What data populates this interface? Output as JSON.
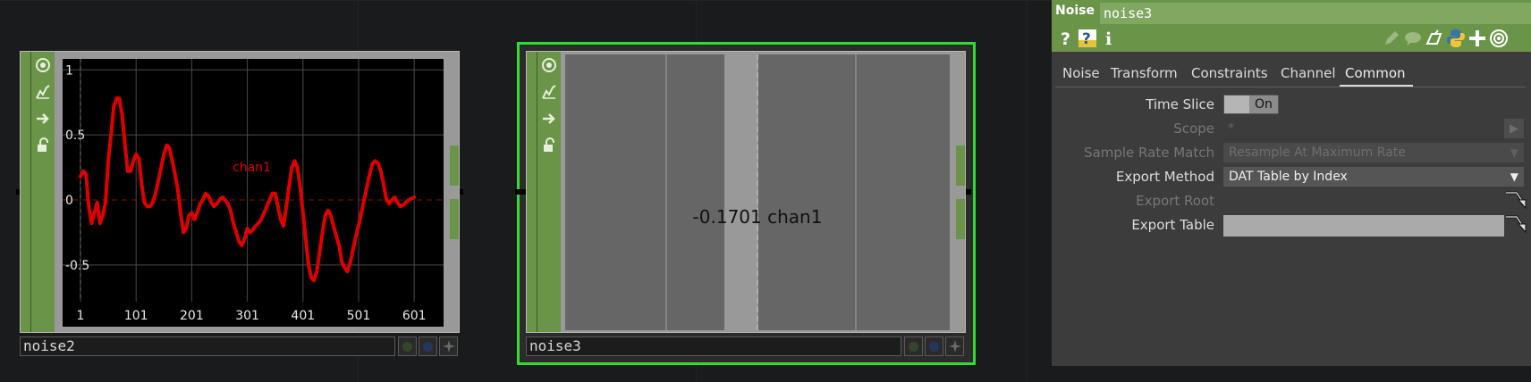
{
  "nodes": {
    "noise2": {
      "name": "noise2",
      "tools": [
        "viewer-active-icon",
        "graph-icon",
        "forward-arrow-icon",
        "lock-icon"
      ],
      "chart_data": {
        "type": "line",
        "title": "",
        "xlabel": "",
        "ylabel": "",
        "xlim": [
          1,
          620
        ],
        "ylim": [
          -0.7,
          1.05
        ],
        "x_ticks": [
          "1",
          "101",
          "201",
          "301",
          "401",
          "501",
          "601"
        ],
        "y_ticks": [
          "1",
          "0.5",
          "0",
          "-0.5"
        ],
        "grid": true,
        "series": [
          {
            "name": "chan1",
            "color": "#e00000",
            "x": [
              1,
              6,
              11,
              16,
              21,
              26,
              31,
              36,
              41,
              46,
              51,
              56,
              61,
              66,
              71,
              76,
              81,
              86,
              91,
              96,
              101,
              106,
              111,
              116,
              121,
              126,
              131,
              136,
              141,
              146,
              151,
              156,
              161,
              166,
              171,
              176,
              181,
              186,
              191,
              196,
              201,
              206,
              211,
              216,
              221,
              226,
              231,
              236,
              241,
              246,
              251,
              256,
              261,
              266,
              271,
              276,
              281,
              286,
              291,
              296,
              301,
              306,
              311,
              316,
              321,
              326,
              331,
              336,
              341,
              346,
              351,
              356,
              361,
              366,
              371,
              376,
              381,
              386,
              391,
              396,
              401,
              406,
              411,
              416,
              421,
              426,
              431,
              436,
              441,
              446,
              451,
              456,
              461,
              466,
              471,
              476,
              481,
              486,
              491,
              496,
              501,
              506,
              511,
              516,
              521,
              526,
              531,
              536,
              541,
              546,
              551,
              556,
              561,
              566,
              571,
              576,
              581,
              586,
              591,
              596,
              601
            ],
            "y": [
              0.18,
              0.22,
              0.2,
              -0.05,
              -0.18,
              -0.1,
              -0.02,
              -0.18,
              -0.12,
              -0.02,
              0.3,
              0.5,
              0.72,
              0.78,
              0.78,
              0.65,
              0.42,
              0.22,
              0.22,
              0.3,
              0.35,
              0.32,
              0.12,
              -0.02,
              -0.05,
              -0.05,
              -0.02,
              0.05,
              0.15,
              0.25,
              0.35,
              0.42,
              0.4,
              0.3,
              0.2,
              0.08,
              -0.1,
              -0.25,
              -0.22,
              -0.12,
              -0.1,
              -0.15,
              -0.1,
              -0.03,
              0.0,
              0.05,
              0.03,
              -0.02,
              -0.05,
              -0.03,
              0.0,
              0.02,
              0.0,
              -0.03,
              -0.08,
              -0.18,
              -0.25,
              -0.32,
              -0.35,
              -0.3,
              -0.22,
              -0.25,
              -0.23,
              -0.2,
              -0.18,
              -0.15,
              -0.1,
              -0.05,
              0.0,
              0.05,
              0.05,
              -0.05,
              -0.15,
              -0.2,
              -0.05,
              0.1,
              0.25,
              0.3,
              0.25,
              0.1,
              -0.1,
              -0.3,
              -0.5,
              -0.6,
              -0.62,
              -0.55,
              -0.4,
              -0.25,
              -0.12,
              -0.08,
              -0.12,
              -0.2,
              -0.28,
              -0.35,
              -0.48,
              -0.52,
              -0.55,
              -0.48,
              -0.38,
              -0.28,
              -0.2,
              -0.1,
              0.0,
              0.1,
              0.2,
              0.28,
              0.3,
              0.28,
              0.22,
              0.12,
              0.0,
              -0.03,
              0.0,
              0.02,
              -0.02,
              -0.05,
              -0.04,
              -0.02,
              0.0,
              0.01,
              0.02
            ]
          }
        ]
      }
    },
    "noise3": {
      "name": "noise3",
      "tools": [
        "viewer-active-icon",
        "graph-icon",
        "forward-arrow-icon",
        "lock-icon"
      ],
      "readout": "-0.1701 chan1"
    }
  },
  "panel": {
    "op_type": "Noise",
    "op_name": "noise3",
    "header_icons": [
      "help-icon",
      "python-help-icon",
      "info-icon",
      "edit-icon",
      "comment-icon",
      "clone-icon",
      "python-icon",
      "add-icon",
      "viewer-icon"
    ],
    "tabs": [
      "Noise",
      "Transform",
      "Constraints",
      "Channel",
      "Common"
    ],
    "active_tab": "Common",
    "params": {
      "time_slice": {
        "label": "Time Slice",
        "value": "On"
      },
      "scope": {
        "label": "Scope",
        "value": "*"
      },
      "sample_rate_match": {
        "label": "Sample Rate Match",
        "value": "Resample At Maximum Rate"
      },
      "export_method": {
        "label": "Export Method",
        "value": "DAT Table by Index"
      },
      "export_root": {
        "label": "Export Root",
        "value": ""
      },
      "export_table": {
        "label": "Export Table",
        "value": ""
      }
    }
  },
  "colors": {
    "op_green": "#6a9548",
    "selection_green": "#2de02d",
    "chart_line": "#e00000"
  }
}
